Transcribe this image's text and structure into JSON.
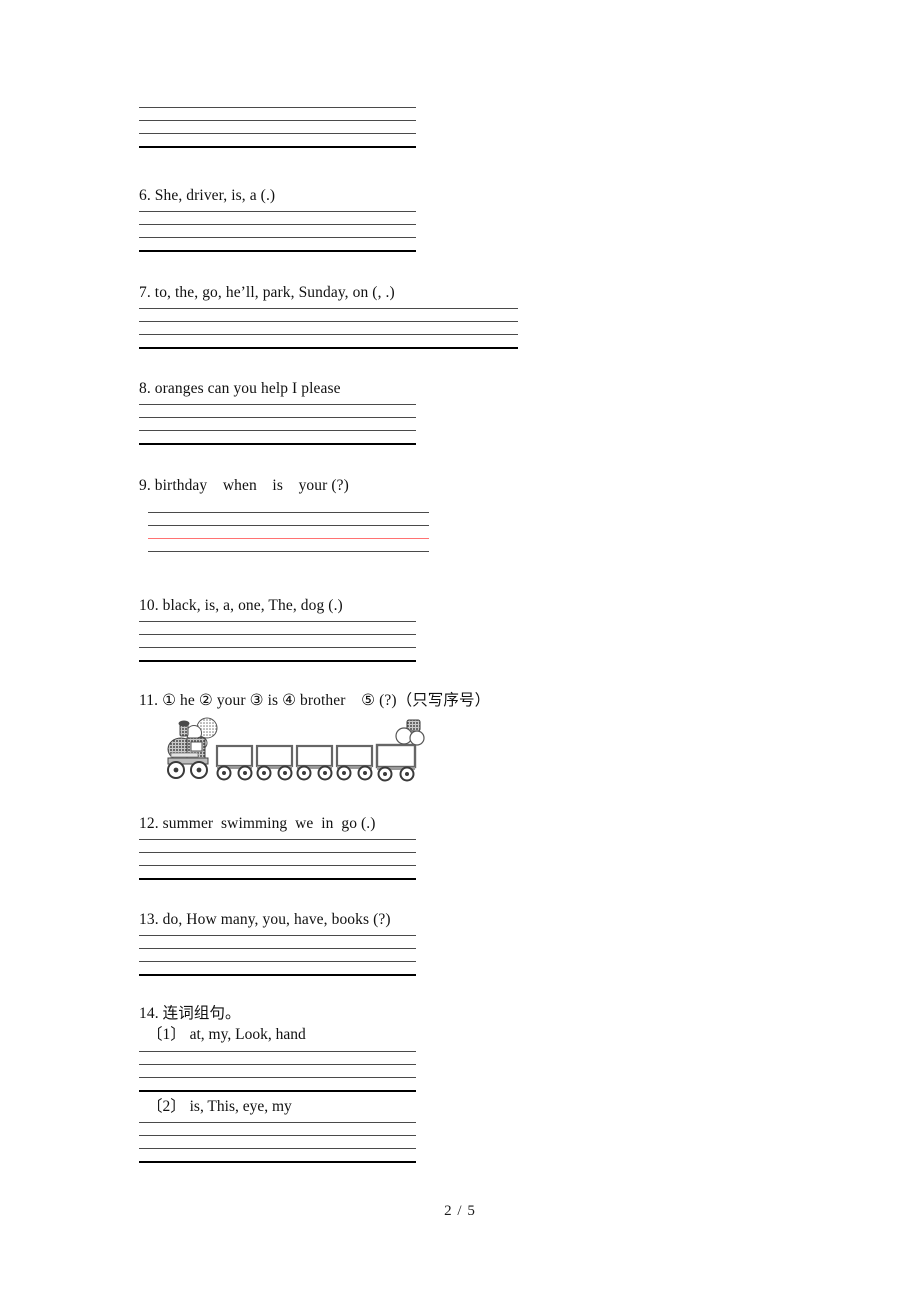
{
  "document": {
    "page_label": "2 / 5",
    "line_colors": {
      "thin_rule": "#4a4a4a",
      "thick_rule": "#000000",
      "red_rule": "#ff7272"
    }
  },
  "items": [
    {
      "id": "item-top-continuation",
      "prompt": "",
      "has_prompt": false,
      "rules": [
        "thin",
        "thin",
        "thin",
        "thick"
      ]
    },
    {
      "id": "item-6",
      "prompt": "6. She, driver, is, a (.)",
      "has_prompt": true,
      "rules": [
        "thin",
        "thin",
        "thin",
        "thick"
      ]
    },
    {
      "id": "item-7",
      "prompt": "7. to, the, go, he’ll, park, Sunday, on (, .)",
      "has_prompt": true,
      "rules": [
        "thin",
        "thin",
        "thin",
        "thick"
      ]
    },
    {
      "id": "item-8",
      "prompt": "8. oranges can you help I please",
      "has_prompt": true,
      "rules": [
        "thin",
        "thin",
        "thin",
        "thick"
      ]
    },
    {
      "id": "item-9",
      "prompt": "9. birthday when is your (?)",
      "has_prompt": true,
      "rules": [
        "thin",
        "thin",
        "red",
        "thin"
      ]
    },
    {
      "id": "item-10",
      "prompt": "10. black, is, a, one, The, dog (.)",
      "has_prompt": true,
      "rules": [
        "thin",
        "thin",
        "thin",
        "thick"
      ]
    },
    {
      "id": "item-11",
      "prompt": "11. ① he ② your ③ is ④ brother ⑤ (?)（只写序号）",
      "has_prompt": true,
      "illustration": "train-with-five-cars",
      "rules": []
    },
    {
      "id": "item-12",
      "prompt": "12. summer swimming we in go (.)",
      "has_prompt": true,
      "rules": [
        "thin",
        "thin",
        "thin",
        "thick"
      ]
    },
    {
      "id": "item-13",
      "prompt": "13. do, How many, you, have, books (?)",
      "has_prompt": true,
      "rules": [
        "thin",
        "thin",
        "thin",
        "thick"
      ]
    },
    {
      "id": "item-14",
      "prompt": "14. 连词组句。",
      "has_prompt": true,
      "subitems": [
        {
          "id": "item-14-1",
          "prompt": "〔1〕 at, my, Look, hand",
          "rules": [
            "thin",
            "thin",
            "thin",
            "thick"
          ]
        },
        {
          "id": "item-14-2",
          "prompt": "〔2〕 is, This, eye, my",
          "rules": [
            "thin",
            "thin",
            "thin",
            "thick"
          ]
        }
      ]
    }
  ]
}
